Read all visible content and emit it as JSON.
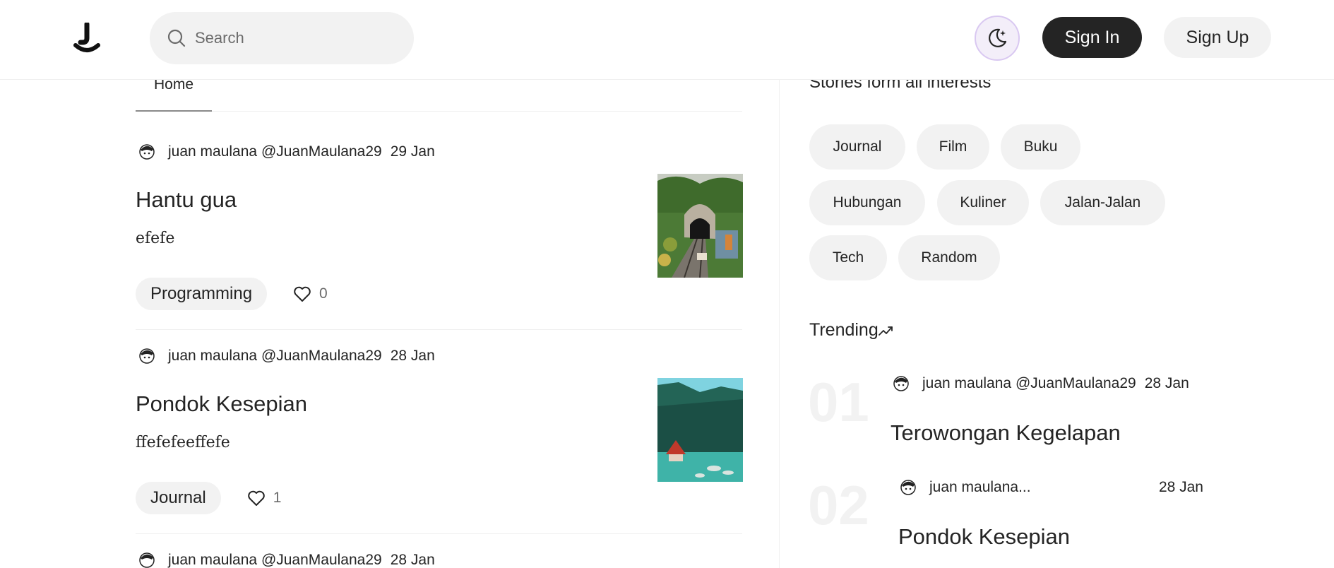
{
  "header": {
    "search_placeholder": "Search",
    "signin_label": "Sign In",
    "signup_label": "Sign Up"
  },
  "feed": {
    "tab_home": "Home",
    "posts": [
      {
        "author": "juan maulana",
        "handle": "@JuanMaulana29",
        "date": "29 Jan",
        "title": "Hantu gua",
        "body": "efefe",
        "tag": "Programming",
        "likes": "0"
      },
      {
        "author": "juan maulana",
        "handle": "@JuanMaulana29",
        "date": "28 Jan",
        "title": "Pondok Kesepian",
        "body": "ffefefeeffefe",
        "tag": "Journal",
        "likes": "1"
      },
      {
        "author": "juan maulana",
        "handle": "@JuanMaulana29",
        "date": "28 Jan"
      }
    ]
  },
  "sidebar": {
    "heading": "Stories form all interests",
    "topics": [
      "Journal",
      "Film",
      "Buku",
      "Hubungan",
      "Kuliner",
      "Jalan-Jalan",
      "Tech",
      "Random"
    ],
    "trending_title": "Trending",
    "trending": [
      {
        "rank": "01",
        "author": "juan maulana",
        "handle": "@JuanMaulana29",
        "date": "28 Jan",
        "title": "Terowongan Kegelapan"
      },
      {
        "rank": "02",
        "author": "juan maulana...",
        "date": "28 Jan",
        "title": "Pondok Kesepian"
      }
    ]
  },
  "icons": {
    "logo": "logo-icon",
    "search": "search-icon",
    "theme": "moon-sparkle-icon",
    "like": "heart-icon",
    "avatar": "avatar-icon",
    "trending": "trending-up-icon"
  },
  "colors": {
    "primary_button": "#242424",
    "chip_bg": "#f2f2f2",
    "theme_button_border": "#d9c8f1"
  }
}
